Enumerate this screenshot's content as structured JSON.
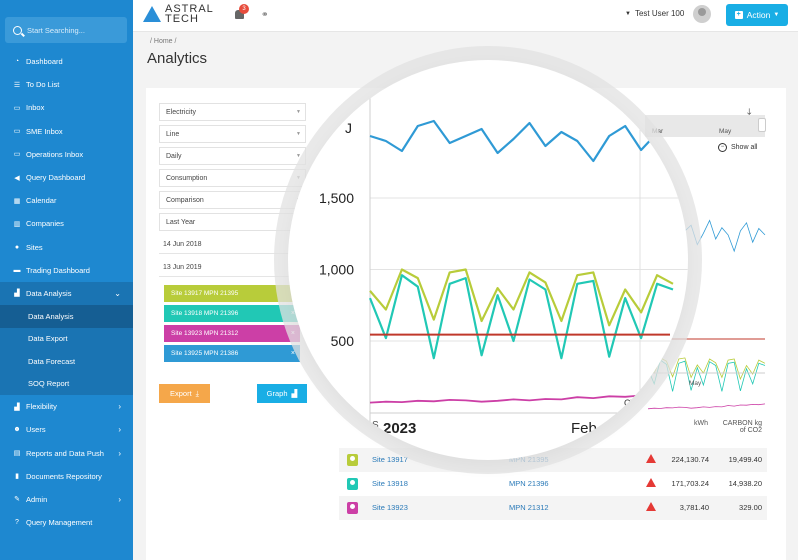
{
  "search": {
    "placeholder": "Start Searching..."
  },
  "sidebar": {
    "items": [
      {
        "label": "Dashboard",
        "icon": "dashboard-icon",
        "glyph": "◔"
      },
      {
        "label": "To Do List",
        "icon": "list-icon",
        "glyph": "☰"
      },
      {
        "label": "Inbox",
        "icon": "inbox-icon",
        "glyph": "▭"
      },
      {
        "label": "SME Inbox",
        "icon": "inbox-icon",
        "glyph": "▭"
      },
      {
        "label": "Operations Inbox",
        "icon": "inbox-icon",
        "glyph": "▭"
      },
      {
        "label": "Query Dashboard",
        "icon": "megaphone-icon",
        "glyph": "◀"
      },
      {
        "label": "Calendar",
        "icon": "calendar-icon",
        "glyph": "▦"
      },
      {
        "label": "Companies",
        "icon": "building-icon",
        "glyph": "▥"
      },
      {
        "label": "Sites",
        "icon": "map-pin-icon",
        "glyph": "●"
      },
      {
        "label": "Trading Dashboard",
        "icon": "money-icon",
        "glyph": "▬"
      },
      {
        "label": "Data Analysis",
        "icon": "chart-icon",
        "glyph": "▟"
      }
    ],
    "subitems": [
      "Data Analysis",
      "Data Export",
      "Data Forecast",
      "SOQ Report"
    ],
    "items_after": [
      {
        "label": "Flexibility",
        "icon": "chart-icon",
        "glyph": "▟",
        "chevron": true
      },
      {
        "label": "Users",
        "icon": "users-icon",
        "glyph": "☻",
        "chevron": true
      },
      {
        "label": "Reports and Data Push",
        "icon": "report-icon",
        "glyph": "▤",
        "chevron": true
      },
      {
        "label": "Documents Repository",
        "icon": "book-icon",
        "glyph": "▮",
        "chevron": false
      },
      {
        "label": "Admin",
        "icon": "wrench-icon",
        "glyph": "✎",
        "chevron": true
      },
      {
        "label": "Query Management",
        "icon": "question-icon",
        "glyph": "?",
        "chevron": false
      }
    ]
  },
  "header": {
    "brand_line1": "ASTRAL",
    "brand_line2": "TECH",
    "notification_count": "3",
    "user_name": "Test User 100",
    "action_label": "Action"
  },
  "breadcrumb": "/ Home /",
  "page_title": "Analytics",
  "filters": {
    "selects": [
      "Electricity",
      "Line",
      "Daily",
      "Consumption",
      "Comparison",
      "Last Year"
    ],
    "date_from": "14 Jun 2018",
    "date_to": "13 Jun 2019"
  },
  "sites": [
    {
      "label": "Site 13917 MPN 21395",
      "color": "#b8cc3a"
    },
    {
      "label": "Site 13918 MPN 21396",
      "color": "#21c8b5"
    },
    {
      "label": "Site 13923 MPN 21312",
      "color": "#cc3fa6"
    },
    {
      "label": "Site 13925 MPN 21386",
      "color": "#2f9ad5"
    }
  ],
  "buttons": {
    "export": "Export",
    "graph": "Graph"
  },
  "chart_controls": {
    "range_months": [
      "Mar",
      "May"
    ],
    "show_all": "Show all",
    "small_axis_month": "May"
  },
  "chart_data": {
    "type": "line",
    "yticks": [
      "500",
      "1,000",
      "1,500"
    ],
    "top_tick_fragment": "J",
    "xticks": [
      "2023",
      "Feb"
    ],
    "right_edge_label": "C)",
    "series": [
      {
        "color": "#2f9ad5",
        "values": [
          1750,
          1700,
          1600,
          1850,
          1900,
          1680,
          1750,
          1820,
          1580,
          1720,
          1880,
          1650,
          1790,
          1700,
          1500,
          1750,
          1850,
          1610,
          1780,
          1700
        ]
      },
      {
        "color": "#b8cc3a",
        "values": [
          850,
          720,
          1000,
          940,
          650,
          980,
          1000,
          640,
          870,
          720,
          980,
          910,
          640,
          960,
          980,
          610,
          860,
          700,
          960,
          900
        ]
      },
      {
        "color": "#21c8b5",
        "values": [
          800,
          520,
          960,
          880,
          380,
          900,
          940,
          400,
          820,
          500,
          930,
          860,
          380,
          900,
          920,
          390,
          800,
          520,
          900,
          860
        ]
      },
      {
        "color": "#cc3fa6",
        "values": [
          60,
          70,
          65,
          80,
          75,
          90,
          85,
          70,
          80,
          95,
          85,
          100,
          95,
          120,
          110,
          130,
          125,
          140,
          135,
          150
        ]
      }
    ],
    "reference_line": {
      "color": "#c0392b",
      "value": 545
    },
    "ylim": [
      0,
      1800
    ]
  },
  "table": {
    "headers": {
      "kwh": "kWh",
      "co2_line1": "CARBON kg",
      "co2_line2": "of CO2",
      "left_fragment": "S"
    },
    "rows": [
      {
        "site": "Site 13917",
        "mpn": "MPN 21395",
        "kwh": "224,130.74",
        "co2": "19,499.40",
        "color": "#b8cc3a"
      },
      {
        "site": "Site 13918",
        "mpn": "MPN 21396",
        "kwh": "171,703.24",
        "co2": "14,938.20",
        "color": "#21c8b5"
      },
      {
        "site": "Site 13923",
        "mpn": "MPN 21312",
        "kwh": "3,781.40",
        "co2": "329.00",
        "color": "#cc3fa6"
      }
    ]
  }
}
